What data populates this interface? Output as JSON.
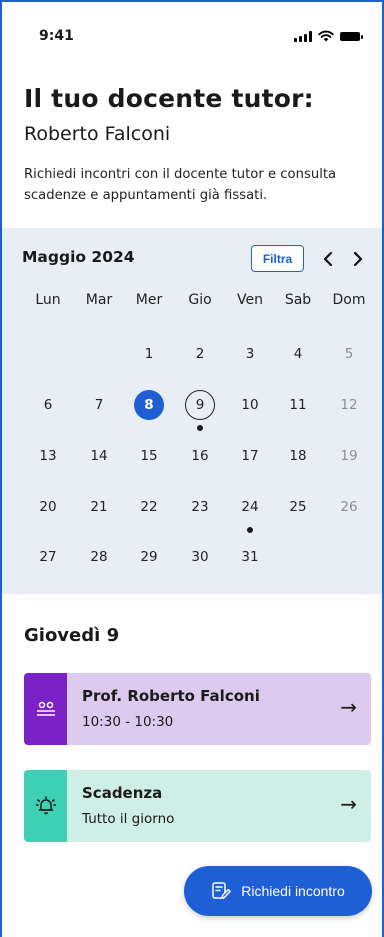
{
  "status_bar": {
    "time": "9:41"
  },
  "header": {
    "title": "Il tuo docente tutor:",
    "tutor_name": "Roberto Falconi",
    "description": "Richiedi incontri con il docente tutor e consulta scadenze e appuntamenti già fissati."
  },
  "calendar": {
    "month_label": "Maggio 2024",
    "filter_label": "Filtra",
    "prev_icon": "chevron-left-icon",
    "next_icon": "chevron-right-icon",
    "weekdays": [
      "Lun",
      "Mar",
      "Mer",
      "Gio",
      "Ven",
      "Sab",
      "Dom"
    ],
    "weeks": [
      [
        "",
        "",
        "1",
        "2",
        "3",
        "4",
        "5"
      ],
      [
        "6",
        "7",
        "8",
        "9",
        "10",
        "11",
        "12"
      ],
      [
        "13",
        "14",
        "15",
        "16",
        "17",
        "18",
        "19"
      ],
      [
        "20",
        "21",
        "22",
        "23",
        "24",
        "25",
        "26"
      ],
      [
        "27",
        "28",
        "29",
        "30",
        "31",
        "",
        ""
      ]
    ],
    "selected_day": "8",
    "today_day": "9",
    "days_with_events": [
      "9",
      "24"
    ]
  },
  "agenda": {
    "day_heading": "Giovedì 9",
    "events": [
      {
        "title": "Prof. Roberto Falconi",
        "subtitle": "10:30 - 10:30",
        "icon": "meeting-icon",
        "arrow": "→",
        "accent": "#7a22c7",
        "background": "#dccbef"
      },
      {
        "title": "Scadenza",
        "subtitle": "Tutto il giorno",
        "icon": "alarm-bell-icon",
        "arrow": "→",
        "accent": "#3fd1b5",
        "background": "#cfeee6"
      }
    ]
  },
  "fab": {
    "label": "Richiedi incontro",
    "icon": "request-form-icon"
  },
  "colors": {
    "primary": "#1f5fd6",
    "calendar_bg": "#e9eef5"
  }
}
